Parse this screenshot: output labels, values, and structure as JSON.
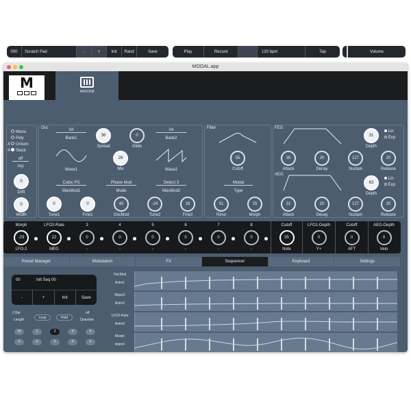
{
  "window": {
    "title": "MOOAL.app"
  },
  "header": {
    "logo_letter": "M",
    "tab_label": "ARGON8"
  },
  "transport": {
    "preset_num": "000",
    "preset_name": "Scratch Pad",
    "minus": "-",
    "plus": "+",
    "init": "Init",
    "rand": "Rand",
    "save": "Save",
    "play": "Play",
    "record": "Record",
    "bpm": "120 bpm",
    "tap": "Tap",
    "volume": "Volume"
  },
  "left": {
    "voice_modes": [
      "Mono",
      "Poly",
      "Unison",
      "Stack"
    ],
    "voice_counts": [
      "4",
      "4"
    ],
    "arp": "off",
    "arp_label": "Arp",
    "drift": "0",
    "drift_label": "Drift",
    "width": "0",
    "width_label": "Width"
  },
  "osc": {
    "title": "Osc",
    "bank1_value": "VA",
    "bank1_label": "Bank1",
    "bank2_value": "VA",
    "bank2_label": "Bank2",
    "spread": "36",
    "spread_label": "Spread",
    "glide": "0",
    "glide_label": "Glide",
    "mix": "28",
    "mix_label": "Mix",
    "wave1_label": "Wave1",
    "wave2_label": "Wave2",
    "wavmod1_value": "Cubic PS",
    "wavmod1_label": "WavMod1",
    "mode_value": "Phase Mod",
    "mode_label": "Mode",
    "wavmod2_value": "Detect 3",
    "wavmod2_label": "WavMod2",
    "tune1": "0",
    "tune1_label": "Tune1",
    "fine1": "0",
    "fine1_label": "Fine1",
    "oscmod": "45",
    "oscmod_label": "OscMod",
    "tune2": "-24",
    "tune2_label": "Tune2",
    "fine2": "18",
    "fine2_label": "Fine2"
  },
  "filter": {
    "title": "Filter",
    "cutoff": "55",
    "cutoff_label": "Cutoff",
    "type_value": "Modal",
    "type_label": "Type",
    "reso": "51",
    "reso_label": "Reso",
    "morph": "25",
    "morph_label": "Morph"
  },
  "feg": {
    "title": "FEG",
    "depth": "31",
    "depth_label": "Depth",
    "lin": "Lin",
    "exp": "Exp",
    "attack": "35",
    "decay": "20",
    "sustain": "127",
    "release": "20",
    "attack_label": "Attack",
    "decay_label": "Decay",
    "sustain_label": "Sustain",
    "release_label": "Release"
  },
  "aeg": {
    "title": "AEG",
    "depth": "63",
    "depth_label": "Depth",
    "lin": "Lin",
    "exp": "Exp",
    "attack": "31",
    "decay": "20",
    "sustain": "127",
    "release": "20",
    "attack_label": "Attack",
    "decay_label": "Decay",
    "sustain_label": "Sustain",
    "release_label": "Release"
  },
  "strip": [
    {
      "top": "Morph",
      "val": "-23",
      "bot": "LFO-2"
    },
    {
      "top": "LFO2-Rate",
      "val": "22",
      "bot": "MEG"
    },
    {
      "top": "3",
      "val": "0",
      "bot": "-"
    },
    {
      "top": "4",
      "val": "0",
      "bot": "-"
    },
    {
      "top": "5",
      "val": "0",
      "bot": "-"
    },
    {
      "top": "6",
      "val": "0",
      "bot": "-"
    },
    {
      "top": "7",
      "val": "0",
      "bot": "-"
    },
    {
      "top": "8",
      "val": "0",
      "bot": "-"
    },
    {
      "top": "Cutoff",
      "val": "35",
      "bot": "Note"
    },
    {
      "top": "LFO1-Depth",
      "val": "0",
      "bot": "Y+"
    },
    {
      "top": "Cutoff",
      "val": "0",
      "bot": "AFT"
    },
    {
      "top": "AEG-Depth",
      "val": "0",
      "bot": "Velo"
    }
  ],
  "tabs": [
    "Preset Manager",
    "Modulation",
    "FX",
    "Sequencer",
    "Keyboard",
    "Settings"
  ],
  "seq": {
    "num": "00",
    "name": "Init Seq 00",
    "minus": "-",
    "plus": "+",
    "init": "Init",
    "save": "Save",
    "length_value": "2 Bar",
    "length_label": "Length",
    "loop": "Loop",
    "hold": "Hold",
    "quantise_value": "off",
    "quantise_label": "Quantise",
    "mutes": [
      "M",
      "1",
      "2",
      "3",
      "4"
    ],
    "clears": [
      "X",
      "X",
      "X",
      "X",
      "X"
    ]
  },
  "tracks": [
    {
      "name": "OscMod",
      "sub": "Anim1"
    },
    {
      "name": "Wave2",
      "sub": "Anim2"
    },
    {
      "name": "LFO2-Rate",
      "sub": "Anim3"
    },
    {
      "name": "Morph",
      "sub": "Anim4"
    }
  ],
  "colors": {
    "panel": "#4d5d70",
    "dark": "#1b1c1e",
    "accent": "#ffffff"
  }
}
